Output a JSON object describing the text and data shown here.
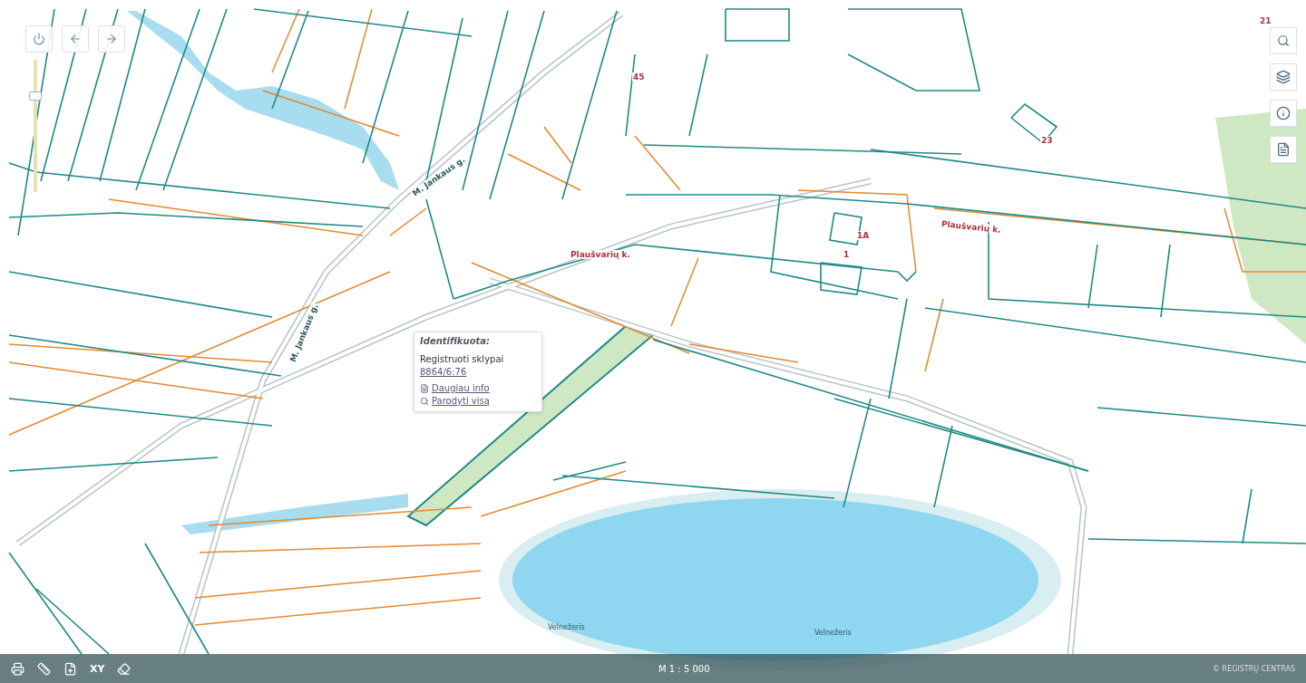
{
  "map": {
    "labels": [
      {
        "kind": "road",
        "text": "M. Jankaus g."
      },
      {
        "kind": "road",
        "text": "M. Jankaus g."
      },
      {
        "kind": "place",
        "text": "Plaušvarių k."
      },
      {
        "kind": "place",
        "text": "Plaušvarių k."
      },
      {
        "kind": "parcel",
        "text": "45"
      },
      {
        "kind": "parcel",
        "text": "23"
      },
      {
        "kind": "parcel",
        "text": "1A"
      },
      {
        "kind": "parcel",
        "text": "1"
      },
      {
        "kind": "parcel",
        "text": "21"
      },
      {
        "kind": "water",
        "text": "Velnežeris"
      },
      {
        "kind": "water",
        "text": "Velnežeris"
      }
    ]
  },
  "zoom_slider": {
    "level": 0.75
  },
  "popup": {
    "title": "Identifikuota:",
    "layer": "Registruoti sklypai",
    "parcel": "8864/6:76",
    "links": [
      "Daugiau info",
      "Parodyti visą"
    ]
  },
  "bottom_bar": {
    "tools": [
      {
        "kind": "print"
      },
      {
        "kind": "ruler"
      },
      {
        "kind": "file-add"
      },
      {
        "kind": "text",
        "label": "XY"
      },
      {
        "kind": "eraser"
      }
    ],
    "scale": "M 1 : 5 000",
    "copyright": "© REGISTRŲ CENTRAS"
  }
}
